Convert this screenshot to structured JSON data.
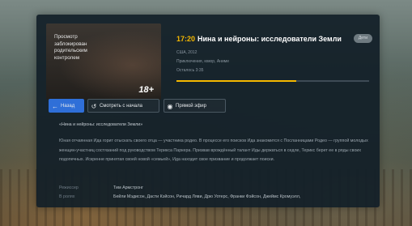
{
  "poster": {
    "restriction_text": "Просмотр заблокирован родительским контролем",
    "age_rating": "18+"
  },
  "program": {
    "time": "17:20",
    "title": "Нина и нейроны: исследователи Земли",
    "badge": "Дети",
    "country_year": "США, 2012",
    "genres": "Приключения, юмор, Аниме",
    "remaining": "Осталось 3:35",
    "progress_percent": 62
  },
  "buttons": {
    "back": "Назад",
    "from_start": "Смотреть с начала",
    "live": "Прямой эфир"
  },
  "description": {
    "title": "«Нина и нейроны: исследователи Земли»",
    "body": "Юная отчаянная Ида горит отыскать своего отца — участника родео. В процессе его поисков Ида знакомится с Посланницами Родео — группой молодых женщин-участниц состязаний под руководством Терикса Паркера. Призвав врождённый талант Иды держаться в седле, Терикс берет ее в ряды своих подопечных. Искренне принятая своей новой «семьей», Ида находит свое призвание и продолжает поиски."
  },
  "credits": {
    "director_label": "Режиссер",
    "director_value": "Тим Армстронг",
    "cast_label": "В ролях",
    "cast_value": "Бейли Мэдисон, Дасти Кэйсон, Ричард Ляви, Дрю Уотерс, Франки Фэйсон, Джеймс Кромуэлл,"
  },
  "colors": {
    "accent": "#f5b800",
    "button_primary": "#2f6fd8",
    "panel": "#121f28"
  },
  "icons": {
    "back": "arrow-left-icon",
    "from_start": "restart-icon",
    "live": "live-record-icon"
  }
}
